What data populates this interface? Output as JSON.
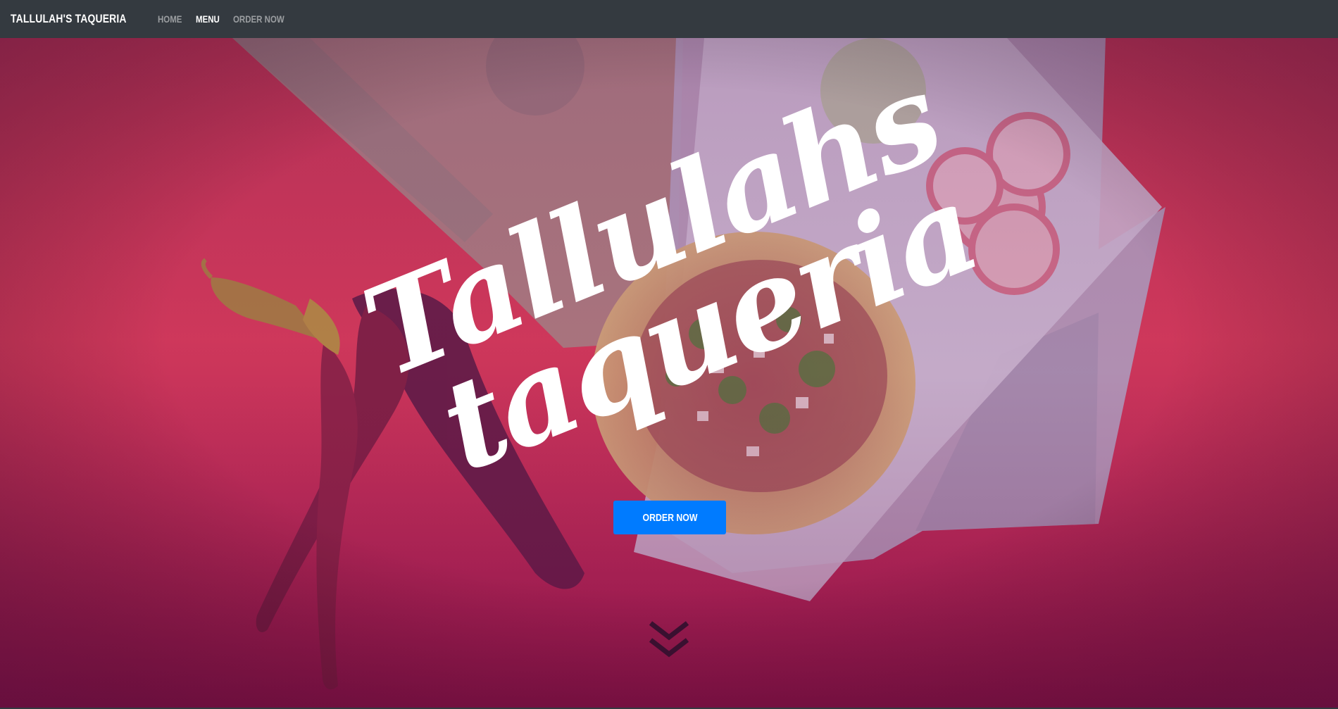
{
  "navbar": {
    "brand": "TALLULAH'S TAQUERIA",
    "links": [
      {
        "label": "HOME",
        "active": false
      },
      {
        "label": "MENU",
        "active": true
      },
      {
        "label": "ORDER NOW",
        "active": false
      }
    ]
  },
  "hero": {
    "title_line1": "Tallulahs",
    "title_line2": "taqueria",
    "cta_label": "ORDER NOW",
    "scroll_icon": "double-chevron-down-icon",
    "background_icon": "taco-chili-photo"
  },
  "colors": {
    "navbar_bg": "#343a40",
    "brand_text": "#ffffff",
    "nav_link_inactive": "rgba(255,255,255,0.5)",
    "nav_link_active": "#ffffff",
    "hero_base": "#d6324f",
    "cta_bg": "#007bff",
    "cta_text": "#ffffff",
    "chevron": "#3a1030"
  }
}
